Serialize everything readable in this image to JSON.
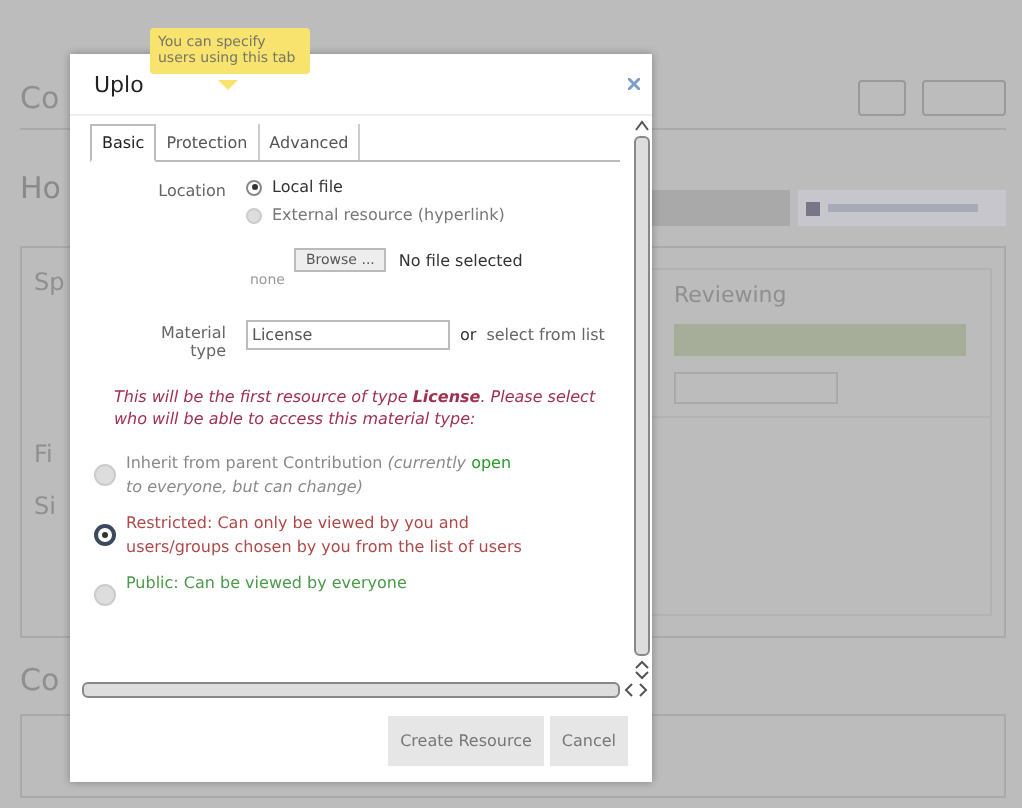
{
  "background": {
    "heading": "Co",
    "subheading": "Ho",
    "labels": [
      "Sp",
      "Fi",
      "Si"
    ],
    "section_heading": "Co",
    "reviewing_title": "Reviewing"
  },
  "dialog": {
    "title": "Uplo",
    "tooltip": "You can specify users using this tab",
    "tabs": [
      {
        "label": "Basic",
        "selected": true
      },
      {
        "label": "Protection",
        "selected": false
      },
      {
        "label": "Advanced",
        "selected": false
      }
    ],
    "location": {
      "label": "Location",
      "options": [
        {
          "label": "Local file",
          "selected": true
        },
        {
          "label": "External resource (hyperlink)",
          "selected": false
        }
      ]
    },
    "file": {
      "button": "Browse ...",
      "status": "No file selected",
      "hint": "none"
    },
    "material": {
      "label": "Material type",
      "value": "License",
      "or": "or",
      "link": "select from list"
    },
    "warning": "This will be the first resource of type **License**. Please select who will be able to access this material type:",
    "access": [
      {
        "text": "Inherit from parent Contribution *(currently*",
        "status": "open",
        "note": "*to everyone, but can change)*",
        "color": "#8a8a8a",
        "selected": false
      },
      {
        "text": "Restricted: Can only be viewed by you and users/groups chosen by you from the list of users",
        "color": "#b04a4a",
        "selected": true
      },
      {
        "text": "Public: Can be viewed by everyone",
        "color": "#4a9a4a",
        "selected": false
      }
    ],
    "buttons": [
      "Create Resource",
      "Cancel"
    ]
  }
}
